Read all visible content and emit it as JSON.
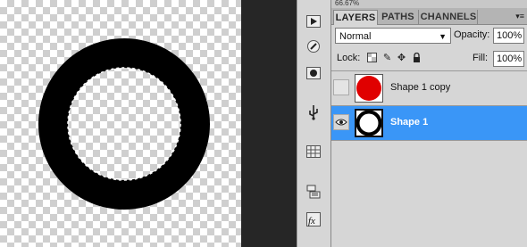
{
  "canvas": {
    "ring_color": "#000000"
  },
  "panel": {
    "zoom_text": "66.67%",
    "tabs": [
      {
        "label": "LAYERS",
        "active": true
      },
      {
        "label": "PATHS",
        "active": false
      },
      {
        "label": "CHANNELS",
        "active": false
      }
    ],
    "blend_mode": "Normal",
    "opacity_label": "Opacity:",
    "opacity_value": "100%",
    "lock_label": "Lock:",
    "fill_label": "Fill:",
    "fill_value": "100%",
    "layers": [
      {
        "name": "Shape 1 copy",
        "visible": false,
        "selected": false,
        "thumb": "red-circle"
      },
      {
        "name": "Shape 1",
        "visible": true,
        "selected": true,
        "thumb": "black-ring"
      }
    ]
  },
  "colors": {
    "selected": "#3a96f7",
    "panel_bg": "#d6d6d6",
    "red": "#e00000"
  }
}
